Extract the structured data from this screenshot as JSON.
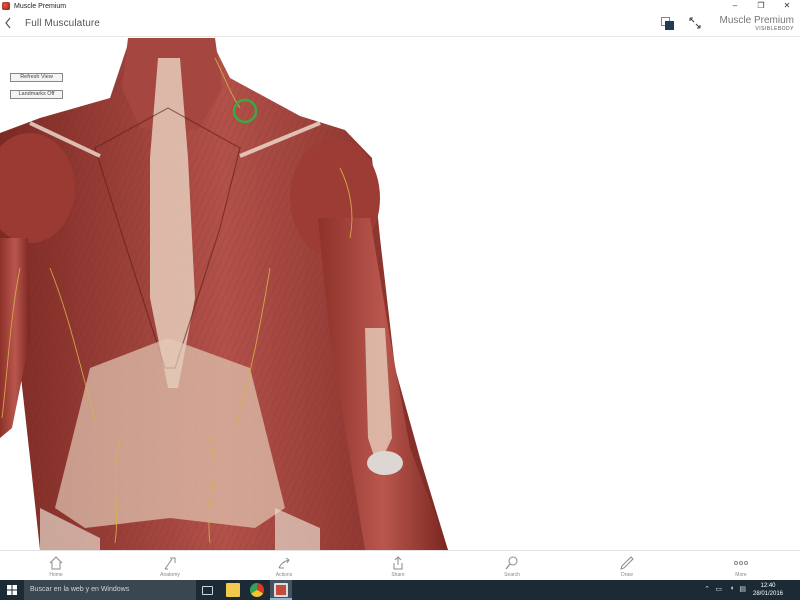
{
  "window": {
    "title": "Muscle Premium",
    "controls": {
      "minimize": "–",
      "restore": "❐",
      "close": "✕"
    }
  },
  "header": {
    "back_icon": "chevron-left-icon",
    "page_title": "Full Musculature",
    "brand_main": "Muscle Premium",
    "brand_sub": "VISIBLEBODY"
  },
  "viewport": {
    "refresh_label": "Refresh View",
    "landmarks_label": "Landmarks Off",
    "selection_color": "#3aa845"
  },
  "toolbar": {
    "items": [
      {
        "label": "Home",
        "icon": "home-icon"
      },
      {
        "label": "Anatomy",
        "icon": "anatomy-icon"
      },
      {
        "label": "Actions",
        "icon": "actions-icon"
      },
      {
        "label": "Share",
        "icon": "share-icon"
      },
      {
        "label": "Search",
        "icon": "search-icon"
      },
      {
        "label": "Draw",
        "icon": "pencil-icon"
      },
      {
        "label": "More",
        "icon": "more-icon"
      }
    ]
  },
  "taskbar": {
    "search_placeholder": "Buscar en la web y en Windows",
    "time": "12:40",
    "date": "28/01/2016"
  },
  "colors": {
    "muscle": "#a2423a",
    "tendon": "#e3cbb8",
    "nerve": "#d6b24a",
    "taskbar": "#1b2a35"
  }
}
